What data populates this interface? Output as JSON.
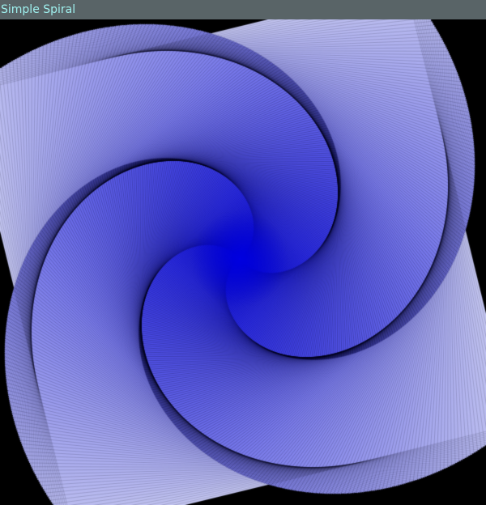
{
  "window": {
    "title": "Simple Spiral"
  },
  "colors": {
    "titlebar_bg": "#596467",
    "title_text": "#9ff0ee",
    "background": "#000000",
    "spiral_core": "#0000e0",
    "spiral_outer": "#c4c6f0",
    "line_color": "#000000"
  },
  "icons": {
    "spiral": "spiral-graphic"
  }
}
